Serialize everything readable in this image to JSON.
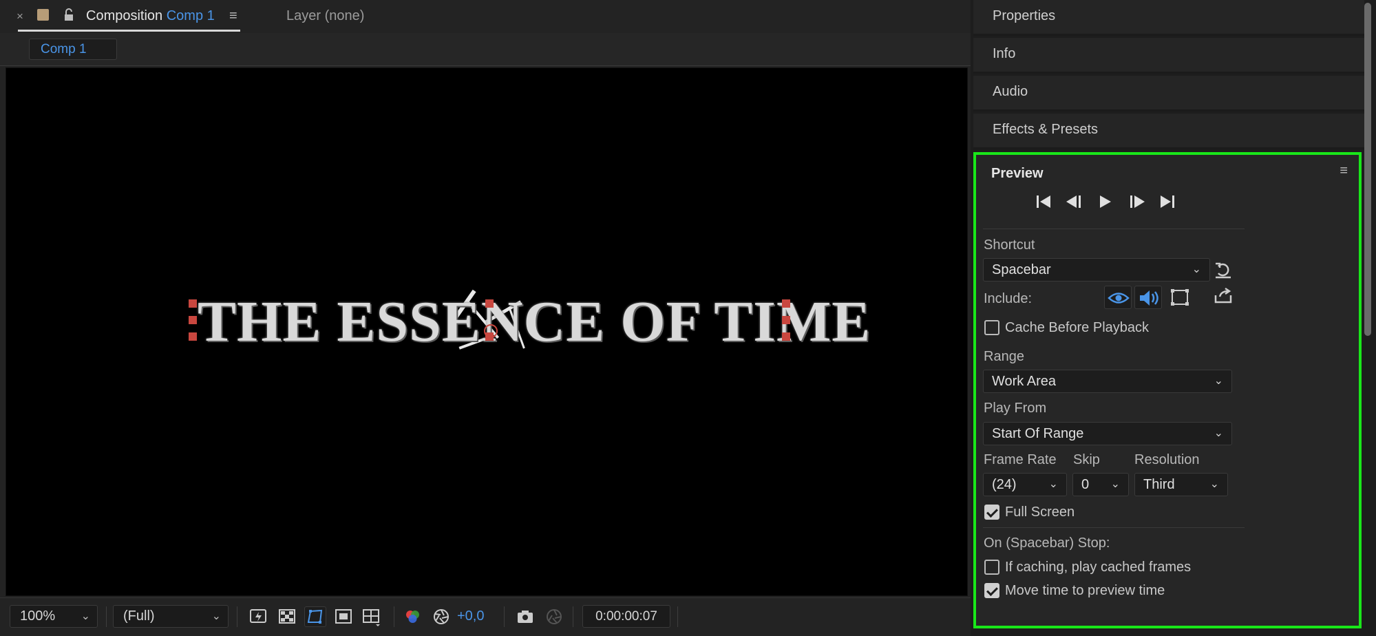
{
  "composition_panel": {
    "tab": {
      "title": "Composition",
      "comp_name": "Comp 1",
      "menu_icon": "hamburger-menu-icon"
    },
    "layer_tab": "Layer (none)",
    "comp_chip": "Comp 1",
    "viewer": {
      "title_text": "THE ESSENCE OF TIME"
    },
    "footer": {
      "zoom": "100%",
      "resolution": "(Full)",
      "exposure": "+0,0",
      "timecode": "0:00:00:07"
    }
  },
  "right_panels": {
    "collapsed": [
      "Properties",
      "Info",
      "Audio",
      "Effects & Presets"
    ]
  },
  "preview": {
    "title": "Preview",
    "shortcut_label": "Shortcut",
    "shortcut_value": "Spacebar",
    "include_label": "Include:",
    "cache_before_playback": {
      "label": "Cache Before Playback",
      "checked": false
    },
    "range_label": "Range",
    "range_value": "Work Area",
    "play_from_label": "Play From",
    "play_from_value": "Start Of Range",
    "frame_rate_label": "Frame Rate",
    "frame_rate_value": "(24)",
    "skip_label": "Skip",
    "skip_value": "0",
    "resolution_label": "Resolution",
    "resolution_value": "Third",
    "full_screen": {
      "label": "Full Screen",
      "checked": true
    },
    "on_stop_label": "On (Spacebar) Stop:",
    "if_caching": {
      "label": "If caching, play cached frames",
      "checked": false
    },
    "move_time": {
      "label": "Move time to preview time",
      "checked": true
    }
  },
  "colors": {
    "accent_blue": "#4a95e8",
    "highlight_green": "#19e619",
    "handle_red": "#c9473f",
    "label_swatch": "#b79d78"
  }
}
